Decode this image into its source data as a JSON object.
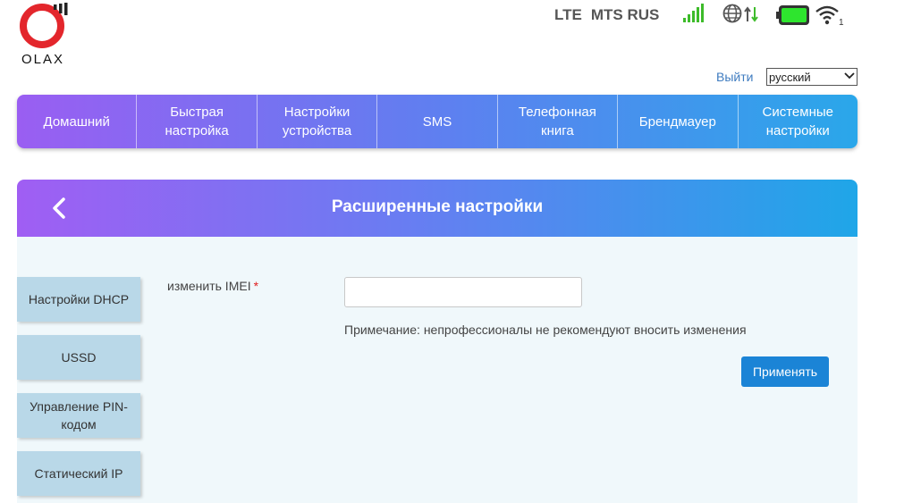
{
  "header": {
    "brand_text": "OLAX",
    "network_type": "LTE",
    "operator": "MTS RUS",
    "wifi_clients": "1"
  },
  "icons": {
    "logo": "olax-logo-icon",
    "signal": "signal-strength-icon",
    "globe": "internet-globe-icon",
    "transfer": "data-transfer-arrows-icon",
    "battery": "battery-icon",
    "wifi": "wifi-icon",
    "back": "chevron-left-icon",
    "dropdown": "chevron-down-icon"
  },
  "colors": {
    "signal": "#3dbb2a",
    "battery_fill": "#2ee52e",
    "logo_red": "#e3262c",
    "accent_button": "#1b84d6",
    "required_marker": "#e02020"
  },
  "top_links": {
    "logout": "Выйти",
    "language_selected": "русский"
  },
  "nav": {
    "items": [
      {
        "label": "Домашний"
      },
      {
        "label": "Быстрая настройка"
      },
      {
        "label": "Настройки устройства"
      },
      {
        "label": "SMS"
      },
      {
        "label": "Телефонная книга"
      },
      {
        "label": "Брендмауер"
      },
      {
        "label": "Системные настройки"
      }
    ]
  },
  "panel": {
    "title": "Расширенные настройки"
  },
  "sidebar": {
    "items": [
      {
        "label": "Настройки DHCP"
      },
      {
        "label": "USSD"
      },
      {
        "label": "Управление PIN-кодом"
      },
      {
        "label": "Статический IP"
      }
    ]
  },
  "form": {
    "imei_label": "изменить IMEI",
    "required_marker": "*",
    "imei_value": "",
    "note": "Примечание: непрофессионалы не рекомендуют вносить изменения",
    "apply_label": "Применять"
  }
}
